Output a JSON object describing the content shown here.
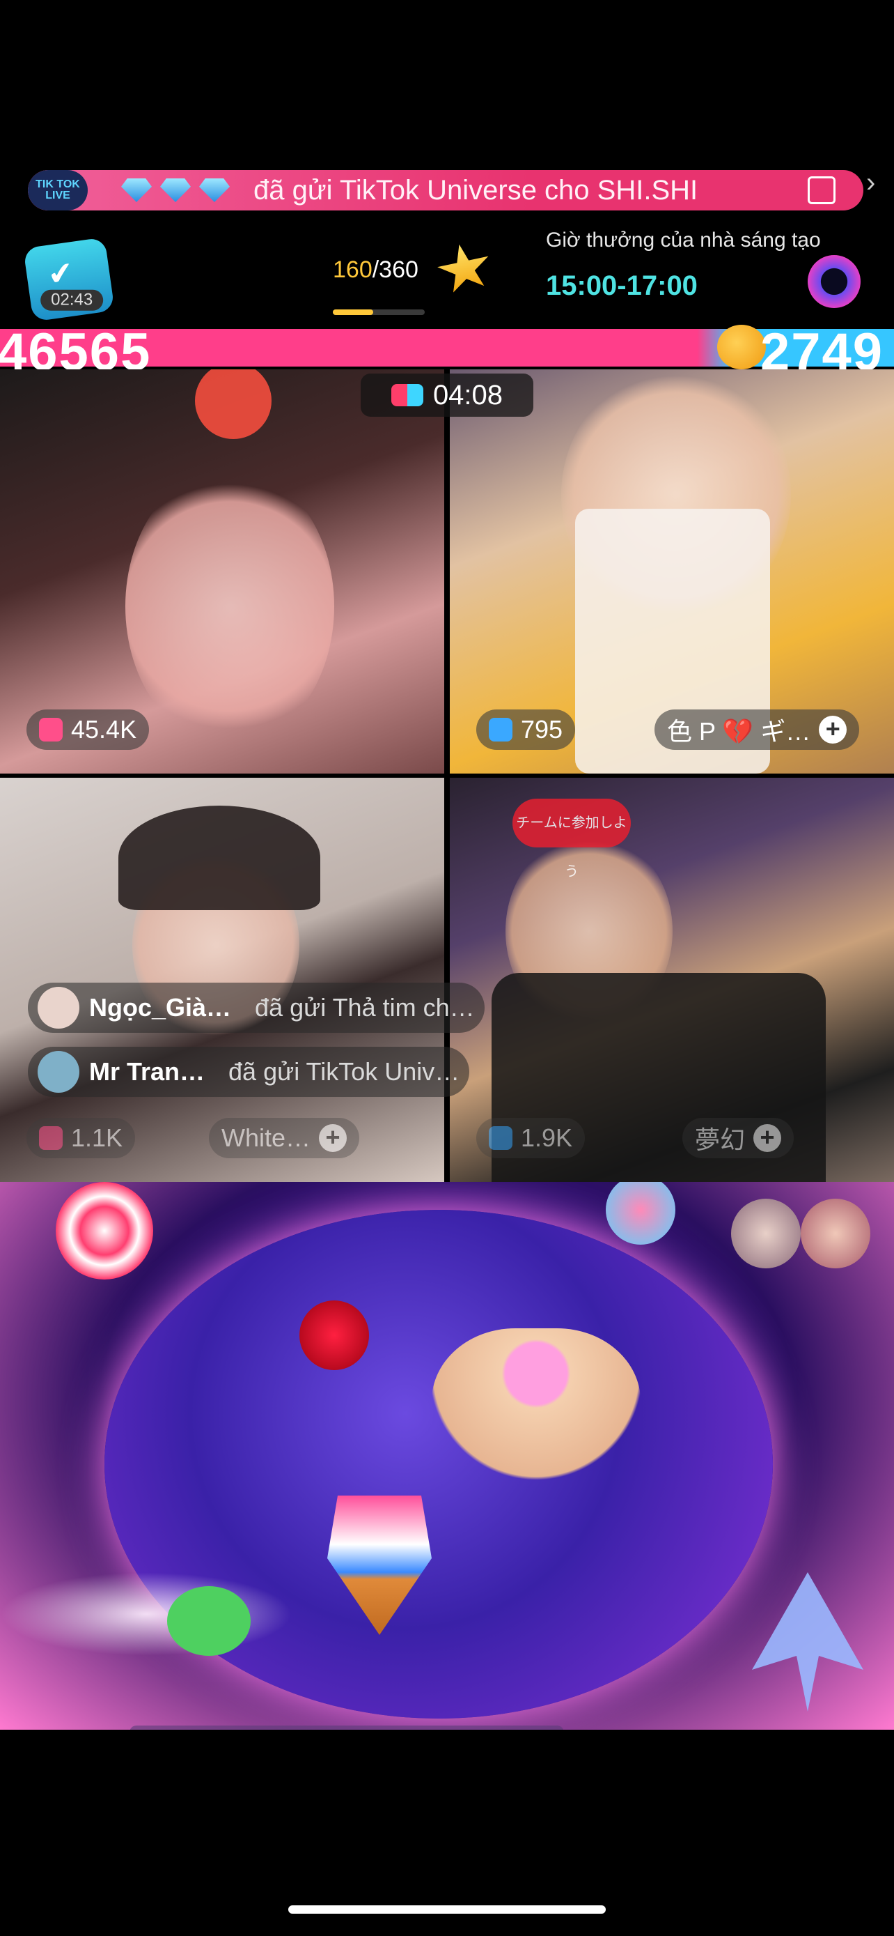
{
  "banner": {
    "logo_text": "TIK TOK LIVE",
    "message": "đã gửi TikTok Universe cho SHI.SHI"
  },
  "header": {
    "timer": "02:43",
    "progress_current": "160",
    "progress_total": "/360",
    "progress_fraction": 0.44,
    "creator_label": "Giờ thưởng của nhà sáng tạo",
    "creator_time": "15:00-17:00"
  },
  "battle": {
    "score_left": "46565",
    "score_right": "2749",
    "timer": "04:08",
    "colors": {
      "left": "#ff3e8a",
      "right": "#36c6ff"
    }
  },
  "tiles": [
    {
      "viewers": "45.4K"
    },
    {
      "viewers": "795",
      "host": "色 P 💔 ギ…"
    },
    {
      "viewers": "1.1K",
      "host": "White…"
    },
    {
      "viewers": "1.9K",
      "host": "夢幻",
      "sign_text": "チームに参加しよう"
    }
  ],
  "comments": [
    {
      "user": "Ngọc_Già…",
      "message": "đã gửi Thả tim ch…"
    },
    {
      "user": "Mr Tran…",
      "message": "đã gửi TikTok Univ…"
    }
  ],
  "icons": {
    "banner_gift": "gift-icon",
    "timer": "check-badge-icon",
    "star": "star-icon",
    "creator": "eye-orb-icon",
    "battle": "versus-icon",
    "viewers": "viewer-icon",
    "add": "plus-icon"
  }
}
